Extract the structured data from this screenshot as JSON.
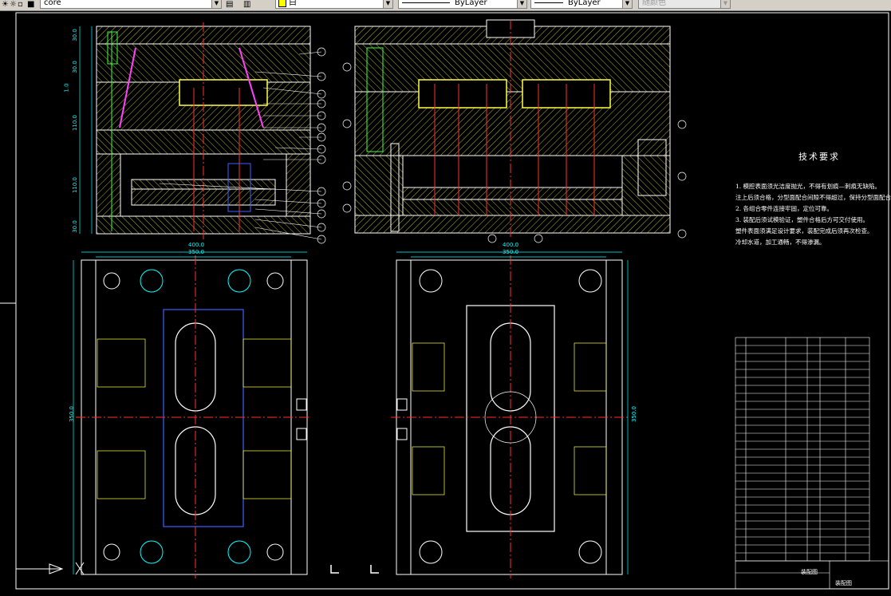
{
  "toolbar": {
    "layer_name": "core",
    "color_value": "白",
    "linetype_value": "ByLayer",
    "lineweight_value": "ByLayer",
    "plotstyle_value": "随颜色"
  },
  "technical_requirements": {
    "title": "技术要求",
    "lines": [
      "1. 模腔表面须光洁度抛光，不得有划痕—刺痕无缺陷。",
      "注上后须合格，分型面配合间隙不得超过，保持分型面配合锐边。",
      "2. 各组合零件连接牢固，定位可靠。",
      "3. 装配后须试模验证，塑件合格后方可交付使用。",
      "塑件表面须满足设计要求，装配完成后须再次检查。",
      "冷却水道，加工通畅，不得渗漏。"
    ]
  },
  "title_block": {
    "drawing_name": "装配图",
    "drawing_name2": "装配图"
  },
  "dimensions": {
    "left_top_width": "400.0",
    "left_inner_width": "350.0",
    "left_height": "350.0",
    "right_top_width": "400.0",
    "right_inner_width": "350.0",
    "right_height": "350.0",
    "section_v1": "30.0",
    "section_v2": "30.0",
    "section_v3": "110.0",
    "section_v4": "110.0",
    "section_v5": "30.0",
    "section_overall": "1.0"
  },
  "colors": {
    "background": "#000000",
    "outline": "#ffffff",
    "dim": "#00ffff",
    "center": "#ff3030",
    "hatch": "#ffff40",
    "magenta": "#ff40ff",
    "green": "#40ff40",
    "blue": "#4060ff"
  }
}
